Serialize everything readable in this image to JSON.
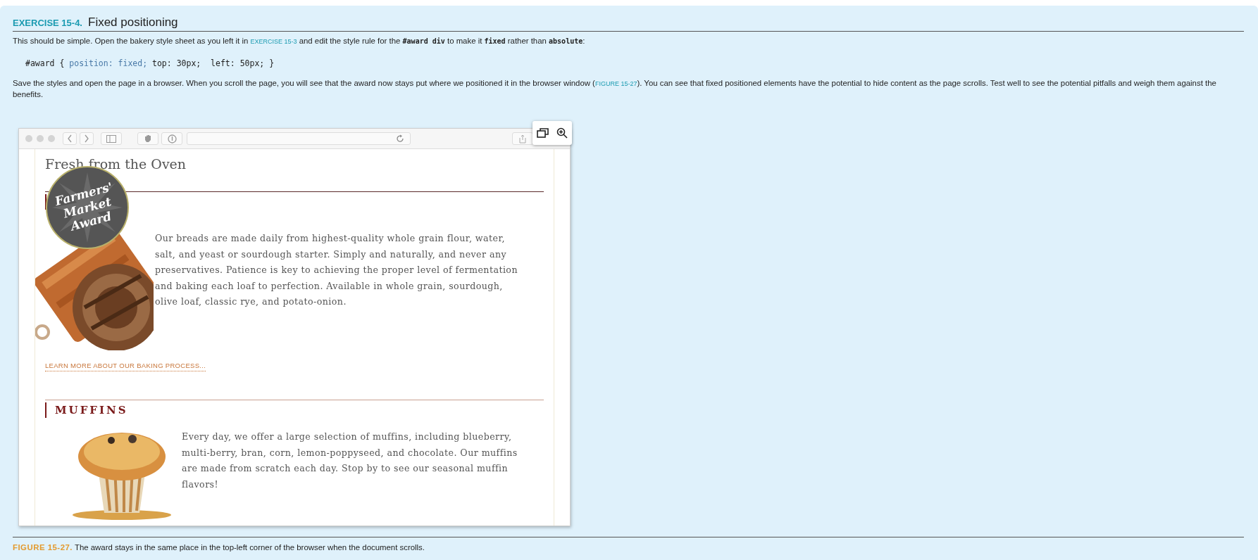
{
  "exercise": {
    "label": "EXERCISE 15-4.",
    "title": "Fixed positioning"
  },
  "intro": [
    {
      "kind": "text",
      "text": "This should be simple. Open the bakery style sheet as you left it in "
    },
    {
      "kind": "link",
      "text": "EXERCISE 15-3"
    },
    {
      "kind": "text",
      "text": " and edit the style rule for the "
    },
    {
      "kind": "code",
      "text": "#award div"
    },
    {
      "kind": "text",
      "text": " to make it "
    },
    {
      "kind": "code",
      "text": "fixed"
    },
    {
      "kind": "text",
      "text": " rather than "
    },
    {
      "kind": "code",
      "text": "absolute"
    },
    {
      "kind": "text",
      "text": ":"
    }
  ],
  "code": {
    "selector": "#award {",
    "declaration": "position: fixed;",
    "rest": "top: 30px;  left: 50px; }"
  },
  "save": [
    {
      "kind": "text",
      "text": "Save the styles and open the page in a browser. When you scroll the page, you will see that the award now stays put where we positioned it in the browser window ("
    },
    {
      "kind": "link",
      "text": "FIGURE 15-27"
    },
    {
      "kind": "text",
      "text": "). You can see that fixed positioned elements have the potential to hide content as the page scrolls. Test well to see the potential pitfalls and weigh them against the benefits."
    }
  ],
  "browser": {
    "page_title": "Fresh from the Oven",
    "award": [
      "Farmers'",
      "Market",
      "Award"
    ],
    "sections": [
      {
        "kind": "picture",
        "paragraph": "Our breads are made daily from highest-quality whole grain flour, water, salt, and yeast or sourdough starter. Simply and naturally, and never any preservatives. Patience is key to achieving the proper level of fermentation and baking each loaf to perfection. Available in whole grain, sourdough, olive loaf, classic rye, and potato-onion.",
        "link": "LEARN MORE ABOUT OUR BAKING PROCESS..."
      },
      {
        "kind": "picture",
        "heading": "MUFFINS",
        "paragraph": "Every day, we offer a large selection of muffins, including blueberry, multi-berry, bran, corn, lemon-poppyseed, and chocolate. Our muffins are made from scratch each day. Stop by to see our seasonal muffin flavors!"
      }
    ]
  },
  "caption": {
    "label": "FIGURE 15-27.",
    "text": "The award stays in the same place in the top-left corner of the browser when the document scrolls."
  }
}
